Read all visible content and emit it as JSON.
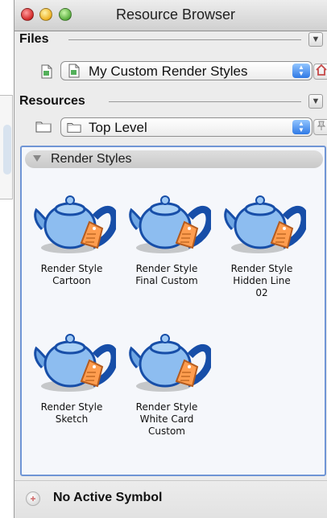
{
  "window": {
    "title": "Resource Browser"
  },
  "files": {
    "label": "Files",
    "selected": "My Custom Render Styles"
  },
  "resources": {
    "label": "Resources",
    "selected": "Top Level",
    "group": "Render Styles",
    "items": [
      {
        "label": "Render Style\nCartoon"
      },
      {
        "label": "Render Style\nFinal Custom"
      },
      {
        "label": "Render Style\nHidden Line\n02"
      },
      {
        "label": "Render Style\nSketch"
      },
      {
        "label": "Render Style\nWhite Card\nCustom"
      }
    ]
  },
  "status": {
    "text": "No Active Symbol"
  },
  "icons": {
    "collapse": "chevron-down-icon",
    "file": "document-icon",
    "folder": "folder-icon",
    "home": "home-icon",
    "pushpin": "pushpin-icon",
    "teapot": "teapot-icon",
    "status": "status-icon"
  },
  "colors": {
    "accent": "#6f95d5",
    "window": "#ececec"
  }
}
